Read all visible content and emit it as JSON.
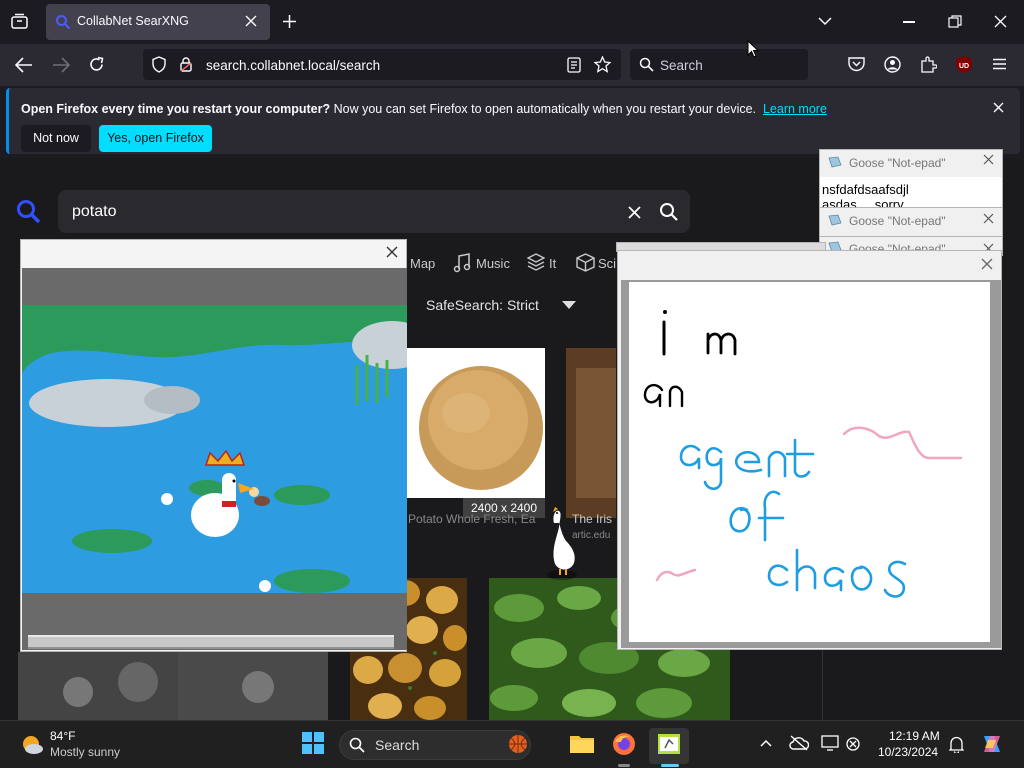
{
  "browser": {
    "tab_title": "CollabNet SearXNG",
    "url": "search.collabnet.local/search",
    "search_placeholder": "Search"
  },
  "notification": {
    "bold": "Open Firefox every time you restart your computer?",
    "text": " Now you can set Firefox to open automatically when you restart your device.",
    "link": "Learn more",
    "not_now": "Not now",
    "yes": "Yes, open Firefox"
  },
  "page": {
    "query": "potato",
    "categories": [
      "Map",
      "Music",
      "It",
      "Sci"
    ],
    "safesearch": "SafeSearch: Strict",
    "result1_dims": "2400 x 2400",
    "result1_caption": "Potato Whole Fresh, Ea",
    "result2_caption": "The Iris",
    "result2_source": "artic.edu"
  },
  "goose_windows": [
    {
      "title": "Goose \"Not-epad\"",
      "text_line1": "nsfdafdsaafsdjl",
      "text_line2": "asdas ... sorry"
    },
    {
      "title": "Goose \"Not-epad\""
    },
    {
      "title": "Goose \"Not-epad\""
    }
  ],
  "drawing": {
    "line1": "i m",
    "line2": "an",
    "line3": "agent",
    "line4": "of",
    "line5": "chaos"
  },
  "taskbar": {
    "temp": "84°F",
    "weather": "Mostly sunny",
    "search": "Search",
    "time": "12:19 AM",
    "date": "10/23/2024"
  },
  "colors": {
    "accent": "#00ddff",
    "firefox_bg": "#1c1b22",
    "searx_icon": "#3050ff"
  }
}
